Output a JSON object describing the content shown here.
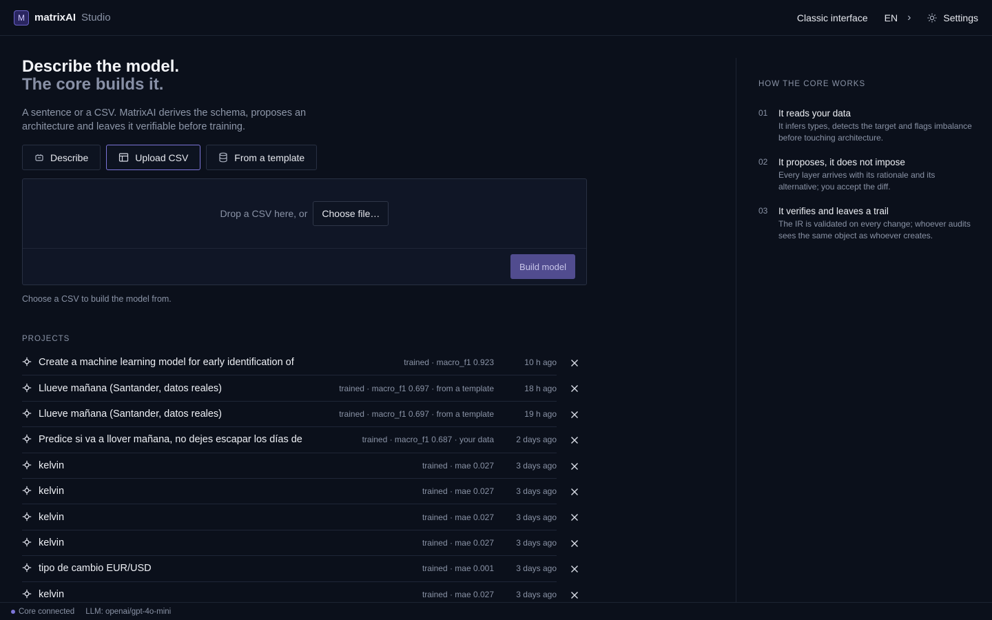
{
  "header": {
    "logo_letter": "M",
    "brand": "matrixAI",
    "brand_sub": "Studio",
    "classic_label": "Classic interface",
    "lang_label": "EN",
    "settings_label": "Settings"
  },
  "hero": {
    "title_line1": "Describe the model.",
    "title_line2": "The core builds it.",
    "lead": "A sentence or a CSV. MatrixAI derives the schema, proposes an architecture and leaves it verifiable before training."
  },
  "tabs": [
    {
      "label": "Describe",
      "icon": "chat-icon",
      "active": false
    },
    {
      "label": "Upload CSV",
      "icon": "table-icon",
      "active": true
    },
    {
      "label": "From a template",
      "icon": "database-icon",
      "active": false
    }
  ],
  "upload": {
    "drop_text": "Drop a CSV here, or",
    "choose_label": "Choose file…",
    "build_label": "Build model",
    "hint": "Choose a CSV to build the model from."
  },
  "projects": {
    "title": "PROJECTS",
    "items": [
      {
        "name": "Create a machine learning model for early identification of",
        "meta": "trained · macro_f1 0.923",
        "time": "10 h ago"
      },
      {
        "name": "Llueve mañana (Santander, datos reales)",
        "meta": "trained · macro_f1 0.697 · from a template",
        "time": "18 h ago"
      },
      {
        "name": "Llueve mañana (Santander, datos reales)",
        "meta": "trained · macro_f1 0.697 · from a template",
        "time": "19 h ago"
      },
      {
        "name": "Predice si va a llover mañana, no dejes escapar los días de",
        "meta": "trained · macro_f1 0.687 · your data",
        "time": "2 days ago"
      },
      {
        "name": "kelvin",
        "meta": "trained · mae 0.027",
        "time": "3 days ago"
      },
      {
        "name": "kelvin",
        "meta": "trained · mae 0.027",
        "time": "3 days ago"
      },
      {
        "name": "kelvin",
        "meta": "trained · mae 0.027",
        "time": "3 days ago"
      },
      {
        "name": "kelvin",
        "meta": "trained · mae 0.027",
        "time": "3 days ago"
      },
      {
        "name": "tipo de cambio EUR/USD",
        "meta": "trained · mae 0.001",
        "time": "3 days ago"
      },
      {
        "name": "kelvin",
        "meta": "trained · mae 0.027",
        "time": "3 days ago"
      }
    ]
  },
  "sidebar": {
    "title": "HOW THE CORE WORKS",
    "steps": [
      {
        "num": "01",
        "title": "It reads your data",
        "desc": "It infers types, detects the target and flags imbalance before touching architecture."
      },
      {
        "num": "02",
        "title": "It proposes, it does not impose",
        "desc": "Every layer arrives with its rationale and its alternative; you accept the diff."
      },
      {
        "num": "03",
        "title": "It verifies and leaves a trail",
        "desc": "The IR is validated on every change; whoever audits sees the same object as whoever creates."
      }
    ]
  },
  "status": {
    "core": "Core connected",
    "llm": "LLM: openai/gpt-4o-mini"
  },
  "colors": {
    "background": "#0b101b",
    "accent": "#7c75d8",
    "build_button": "#514c8f",
    "muted_text": "#8a93a6"
  }
}
